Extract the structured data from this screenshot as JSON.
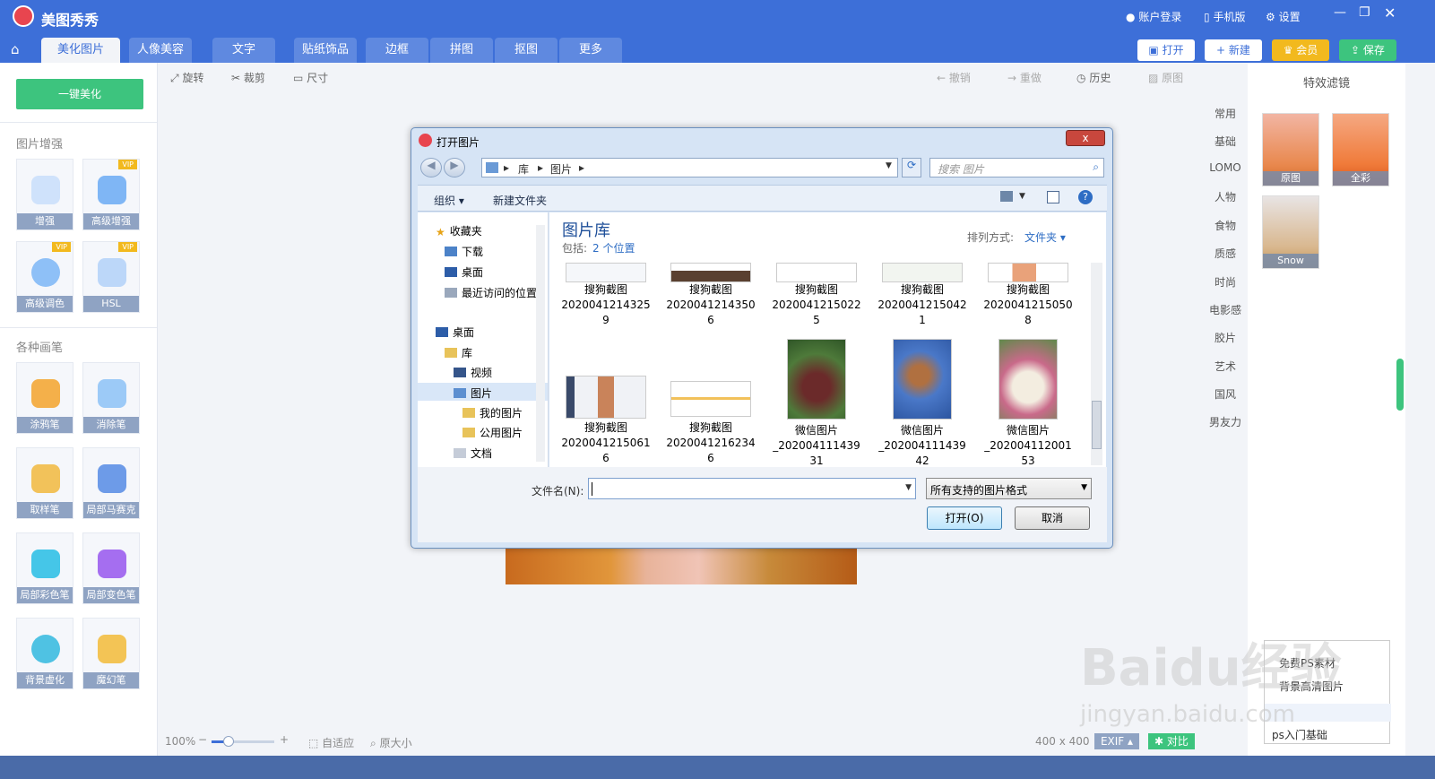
{
  "app": {
    "name": "美图秀秀",
    "account": "账户登录",
    "mobile": "手机版",
    "settings": "设置"
  },
  "tabs": [
    "美化图片",
    "人像美容",
    "文字",
    "贴纸饰品",
    "边框",
    "拼图",
    "抠图",
    "更多"
  ],
  "top_buttons": {
    "open": "打开",
    "new": "新建",
    "vip": "会员",
    "save": "保存"
  },
  "left": {
    "one_click": "一键美化",
    "section1": "图片增强",
    "section2": "各种画笔",
    "vip_tag": "VIP",
    "tools": [
      "增强",
      "高级增强",
      "高级调色",
      "HSL",
      "涂鸦笔",
      "消除笔",
      "取样笔",
      "局部马赛克",
      "局部彩色笔",
      "局部变色笔",
      "背景虚化",
      "魔幻笔"
    ]
  },
  "toolbar": {
    "rotate": "旋转",
    "crop": "裁剪",
    "size": "尺寸",
    "undo": "撤销",
    "redo": "重做",
    "history": "历史",
    "original": "原图"
  },
  "right": {
    "title": "特效滤镜",
    "categories": [
      "常用",
      "基础",
      "LOMO",
      "人物",
      "食物",
      "质感",
      "时尚",
      "电影感",
      "胶片",
      "艺术",
      "国风",
      "男友力"
    ],
    "filters": [
      "原图",
      "全彩",
      "Snow"
    ]
  },
  "dialog": {
    "title": "打开图片",
    "close": "x",
    "path": [
      "库",
      "图片"
    ],
    "search_placeholder": "搜索 图片",
    "organize": "组织 ▾",
    "new_folder": "新建文件夹",
    "nav": {
      "favorites": "收藏夹",
      "downloads": "下载",
      "desktop_fav": "桌面",
      "recent": "最近访问的位置",
      "desktop": "桌面",
      "library": "库",
      "videos": "视频",
      "pictures": "图片",
      "my_pictures": "我的图片",
      "public_pictures": "公用图片",
      "documents": "文档"
    },
    "library_title": "图片库",
    "includes_label": "包括:",
    "includes_link": "2 个位置",
    "sort_label": "排列方式:",
    "sort_value": "文件夹 ▾",
    "files_row1": [
      {
        "l1": "搜狗截图",
        "l2": "2020041214325",
        "l3": "9"
      },
      {
        "l1": "搜狗截图",
        "l2": "2020041214350",
        "l3": "6"
      },
      {
        "l1": "搜狗截图",
        "l2": "2020041215022",
        "l3": "5"
      },
      {
        "l1": "搜狗截图",
        "l2": "2020041215042",
        "l3": "1"
      },
      {
        "l1": "搜狗截图",
        "l2": "2020041215050",
        "l3": "8"
      }
    ],
    "files_row2": [
      {
        "l1": "搜狗截图",
        "l2": "2020041215061",
        "l3": "6"
      },
      {
        "l1": "搜狗截图",
        "l2": "2020041216234",
        "l3": "6"
      },
      {
        "l1": "微信图片",
        "l2": "_202004111439",
        "l3": "31"
      },
      {
        "l1": "微信图片",
        "l2": "_202004111439",
        "l3": "42"
      },
      {
        "l1": "微信图片",
        "l2": "_202004112001",
        "l3": "53"
      }
    ],
    "filename_label": "文件名(N):",
    "filename_value": "",
    "filetype": "所有支持的图片格式",
    "open_button": "打开(O)",
    "cancel_button": "取消"
  },
  "status": {
    "zoom": "100%",
    "fit": "自适应",
    "actual": "原大小",
    "dimensions": "400 x 400",
    "exif": "EXIF ▴",
    "compare": "对比"
  },
  "popup": {
    "item1": "免费PS素材",
    "item2": "背景高清图片",
    "item3": "ps入门基础"
  },
  "watermark": {
    "line1": "Baidu经验",
    "line2": "jingyan.baidu.com"
  }
}
